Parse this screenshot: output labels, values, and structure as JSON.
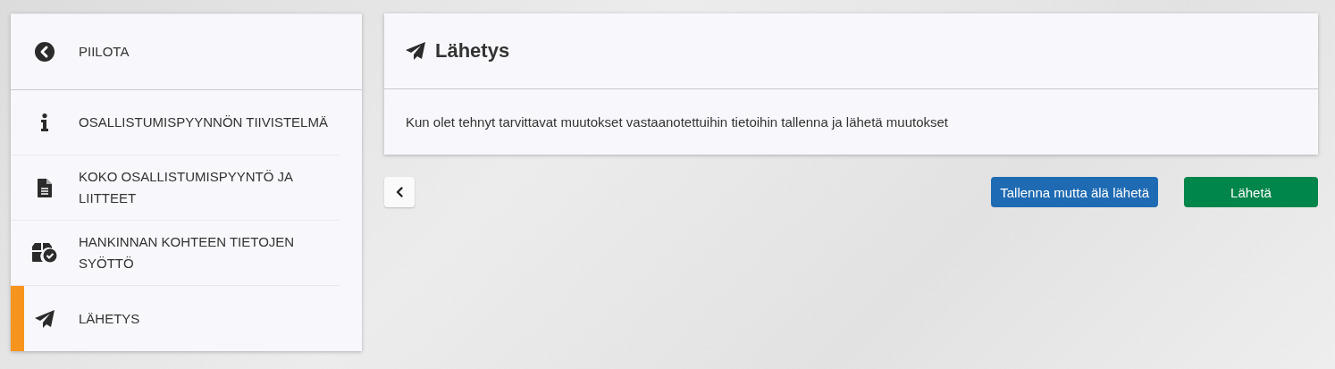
{
  "sidebar": {
    "toggle": {
      "label": "PIILOTA",
      "kind": "collapse"
    },
    "items": [
      {
        "label": "OSALLISTUMISPYYNNÖN TIIVISTELMÄ",
        "kind": "info",
        "selected": false
      },
      {
        "label": "KOKO OSALLISTUMISPYYNTÖ JA LIITTEET",
        "kind": "document",
        "selected": false
      },
      {
        "label": "HANKINNAN KOHTEEN TIETOJEN SYÖTTÖ",
        "kind": "box-check",
        "selected": false
      },
      {
        "label": "LÄHETYS",
        "kind": "send",
        "selected": true
      }
    ]
  },
  "panel": {
    "title": "Lähetys",
    "kind": "send",
    "text": "Kun olet tehnyt tarvittavat muutokset vastaanotettuihin tietoihin tallenna ja lähetä muutokset"
  },
  "actions": {
    "back": {
      "kind": "back"
    },
    "buttons": [
      {
        "label": "Tallenna mutta älä lähetä",
        "kind": "primary"
      },
      {
        "label": "Lähetä",
        "kind": "success"
      }
    ]
  }
}
